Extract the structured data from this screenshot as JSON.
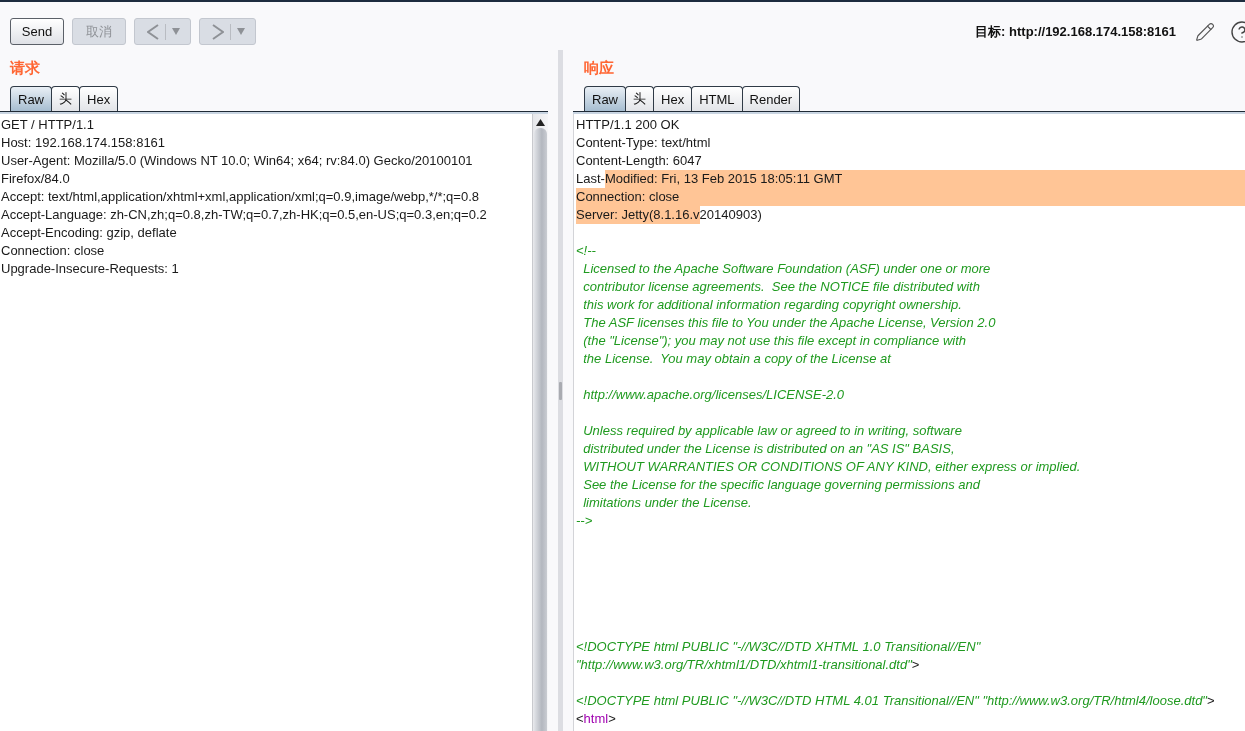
{
  "toolbar": {
    "buttons": [
      {
        "label": "Send",
        "disabled": false
      },
      {
        "label": "取消",
        "disabled": true
      }
    ],
    "history": [
      {
        "kind": "back",
        "disabled": true
      },
      {
        "kind": "forward",
        "disabled": true
      }
    ],
    "target": "目标: http://192.168.174.158:8161"
  },
  "request": {
    "title": "请求",
    "tabs": [
      {
        "label": "Raw",
        "selected": true
      },
      {
        "label": "头",
        "selected": false
      },
      {
        "label": "Hex",
        "selected": false
      }
    ],
    "lines": [
      "GET / HTTP/1.1",
      "Host: 192.168.174.158:8161",
      "User-Agent: Mozilla/5.0 (Windows NT 10.0; Win64; x64; rv:84.0) Gecko/20100101",
      "Firefox/84.0",
      "Accept: text/html,application/xhtml+xml,application/xml;q=0.9,image/webp,*/*;q=0.8",
      "Accept-Language: zh-CN,zh;q=0.8,zh-TW;q=0.7,zh-HK;q=0.5,en-US;q=0.3,en;q=0.2",
      "Accept-Encoding: gzip, deflate",
      "Connection: close",
      "Upgrade-Insecure-Requests: 1"
    ]
  },
  "response": {
    "title": "响应",
    "tabs": [
      {
        "label": "Raw",
        "selected": true
      },
      {
        "label": "头",
        "selected": false
      },
      {
        "label": "Hex",
        "selected": false
      },
      {
        "label": "HTML",
        "selected": false
      },
      {
        "label": "Render",
        "selected": false
      }
    ],
    "lines": [
      {
        "kind": "text",
        "segments": [
          {
            "kind": "plain",
            "text": "HTTP/1.1 200 OK",
            "highlighted": false
          }
        ]
      },
      {
        "kind": "text",
        "segments": [
          {
            "kind": "plain",
            "text": "Content-Type: text/html",
            "highlighted": false
          }
        ]
      },
      {
        "kind": "text",
        "segments": [
          {
            "kind": "plain",
            "text": "Content-Length: 6047",
            "highlighted": false
          }
        ]
      },
      {
        "kind": "text",
        "segments": [
          {
            "kind": "plain",
            "text": "Last-",
            "highlighted": false
          },
          {
            "kind": "plain",
            "text": "Modified: Fri, 13 Feb 2015 18:05:11 GMT",
            "highlighted": true
          }
        ]
      },
      {
        "kind": "text",
        "segments": [
          {
            "kind": "plain",
            "text": "Connection: close",
            "highlighted": true
          }
        ]
      },
      {
        "kind": "text",
        "segments": [
          {
            "kind": "plain",
            "text": "Server: Jetty(8.1.16.v",
            "highlighted": true
          },
          {
            "kind": "plain",
            "text": "20140903)",
            "highlighted": false
          }
        ]
      },
      {
        "kind": "blank"
      },
      {
        "kind": "text",
        "segments": [
          {
            "kind": "comment",
            "text": "<!--",
            "highlighted": false
          }
        ]
      },
      {
        "kind": "text",
        "segments": [
          {
            "kind": "comment",
            "text": "  Licensed to the Apache Software Foundation (ASF) under one or more",
            "highlighted": false
          }
        ]
      },
      {
        "kind": "text",
        "segments": [
          {
            "kind": "comment",
            "text": "  contributor license agreements.  See the NOTICE file distributed with",
            "highlighted": false
          }
        ]
      },
      {
        "kind": "text",
        "segments": [
          {
            "kind": "comment",
            "text": "  this work for additional information regarding copyright ownership.",
            "highlighted": false
          }
        ]
      },
      {
        "kind": "text",
        "segments": [
          {
            "kind": "comment",
            "text": "  The ASF licenses this file to You under the Apache License, Version 2.0",
            "highlighted": false
          }
        ]
      },
      {
        "kind": "text",
        "segments": [
          {
            "kind": "comment",
            "text": "  (the \"License\"); you may not use this file except in compliance with",
            "highlighted": false
          }
        ]
      },
      {
        "kind": "text",
        "segments": [
          {
            "kind": "comment",
            "text": "  the License.  You may obtain a copy of the License at",
            "highlighted": false
          }
        ]
      },
      {
        "kind": "blank"
      },
      {
        "kind": "text",
        "segments": [
          {
            "kind": "comment",
            "text": "  http://www.apache.org/licenses/LICENSE-2.0",
            "highlighted": false
          }
        ]
      },
      {
        "kind": "blank"
      },
      {
        "kind": "text",
        "segments": [
          {
            "kind": "comment",
            "text": "  Unless required by applicable law or agreed to in writing, software",
            "highlighted": false
          }
        ]
      },
      {
        "kind": "text",
        "segments": [
          {
            "kind": "comment",
            "text": "  distributed under the License is distributed on an \"AS IS\" BASIS,",
            "highlighted": false
          }
        ]
      },
      {
        "kind": "text",
        "segments": [
          {
            "kind": "comment",
            "text": "  WITHOUT WARRANTIES OR CONDITIONS OF ANY KIND, either express or implied.",
            "highlighted": false
          }
        ]
      },
      {
        "kind": "text",
        "segments": [
          {
            "kind": "comment",
            "text": "  See the License for the specific language governing permissions and",
            "highlighted": false
          }
        ]
      },
      {
        "kind": "text",
        "segments": [
          {
            "kind": "comment",
            "text": "  limitations under the License.",
            "highlighted": false
          }
        ]
      },
      {
        "kind": "text",
        "segments": [
          {
            "kind": "comment",
            "text": "-->",
            "highlighted": false
          }
        ]
      },
      {
        "kind": "blank"
      },
      {
        "kind": "blank"
      },
      {
        "kind": "blank"
      },
      {
        "kind": "blank"
      },
      {
        "kind": "blank"
      },
      {
        "kind": "blank"
      },
      {
        "kind": "text",
        "segments": [
          {
            "kind": "comment",
            "text": "<!DOCTYPE html PUBLIC \"-//W3C//DTD XHTML 1.0 Transitional//EN\"",
            "highlighted": false
          }
        ]
      },
      {
        "kind": "text",
        "segments": [
          {
            "kind": "comment",
            "text": "\"http://www.w3.org/TR/xhtml1/DTD/xhtml1-transitional.dtd\"",
            "highlighted": false
          },
          {
            "kind": "plain",
            "text": ">",
            "highlighted": false
          }
        ]
      },
      {
        "kind": "blank"
      },
      {
        "kind": "text",
        "segments": [
          {
            "kind": "comment",
            "text": "<!DOCTYPE html PUBLIC \"-//W3C//DTD HTML 4.01 Transitional//EN\" \"http://www.w3.org/TR/html4/loose.dtd\"",
            "highlighted": false
          },
          {
            "kind": "plain",
            "text": ">",
            "highlighted": false
          }
        ]
      },
      {
        "kind": "text",
        "segments": [
          {
            "kind": "plain",
            "text": "<",
            "highlighted": false
          },
          {
            "kind": "tag",
            "text": "html",
            "highlighted": false
          },
          {
            "kind": "plain",
            "text": ">",
            "highlighted": false
          }
        ]
      }
    ]
  }
}
